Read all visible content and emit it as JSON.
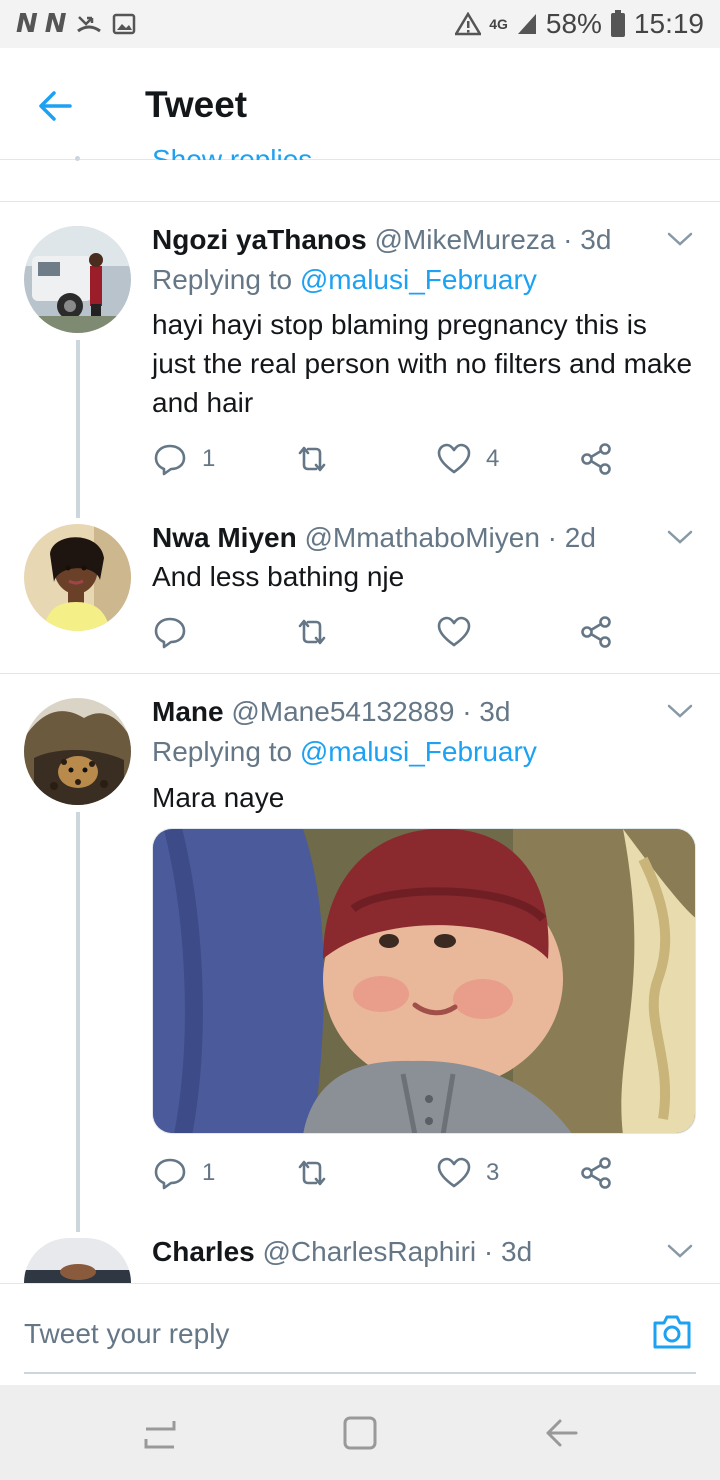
{
  "status_bar": {
    "left_glyphs": "N N",
    "network": "4G",
    "battery": "58%",
    "time": "15:19"
  },
  "header": {
    "title": "Tweet"
  },
  "peek": {
    "show_replies": "Show replies"
  },
  "tweets": [
    {
      "name": "Ngozi yaThanos",
      "handle": "@MikeMureza",
      "time": "· 3d",
      "replying_prefix": "Replying to ",
      "replying_to": "@malusi_February",
      "text": "hayi hayi stop blaming pregnancy this is just the real person with no filters and make and hair",
      "replies": "1",
      "likes": "4"
    },
    {
      "name": "Nwa Miyen",
      "handle": "@MmathaboMiyen",
      "time": "· 2d",
      "text": "And less bathing nje"
    },
    {
      "name": "Mane",
      "handle": "@Mane54132889",
      "time": "· 3d",
      "replying_prefix": "Replying to ",
      "replying_to": "@malusi_February",
      "text": "Mara naye",
      "replies": "1",
      "likes": "3"
    },
    {
      "name": "Charles",
      "handle": "@CharlesRaphiri",
      "time": "· 3d"
    }
  ],
  "reply_bar": {
    "placeholder": "Tweet your reply"
  },
  "colors": {
    "accent": "#1da1f2",
    "secondary_text": "#657786",
    "divider": "#e1e8ed"
  }
}
